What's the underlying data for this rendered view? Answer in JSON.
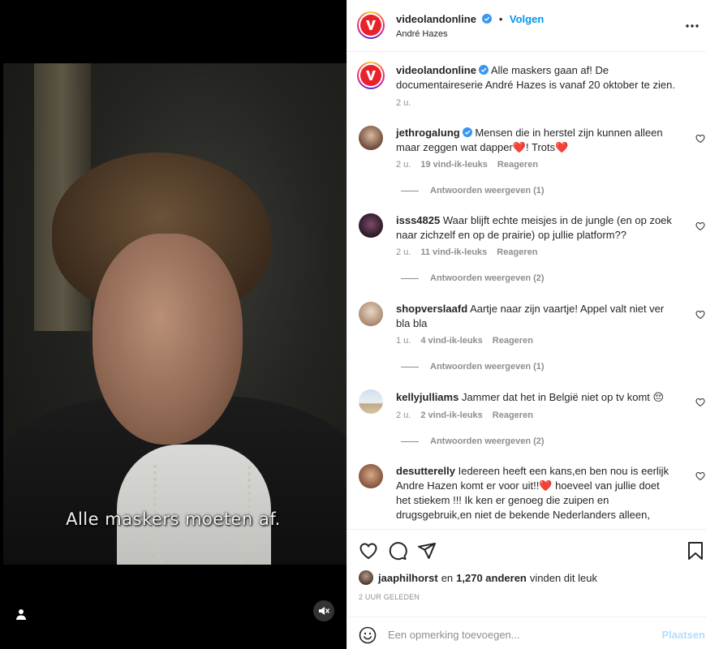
{
  "media": {
    "subtitle": "Alle maskers moeten af."
  },
  "header": {
    "username": "videolandonline",
    "follow_label": "Volgen",
    "separator": "•",
    "location": "André Hazes"
  },
  "caption": {
    "username": "videolandonline",
    "text": "Alle maskers gaan af! De documentaireserie André Hazes is vanaf 20 oktober te zien.",
    "time": "2 u."
  },
  "comments": [
    {
      "username": "jethrogalung",
      "verified": true,
      "text": "Mensen die in herstel zijn kunnen alleen maar zeggen wat dapper❤️! Trots❤️",
      "time": "2 u.",
      "likes": "19 vind-ik-leuks",
      "reply_label": "Reageren",
      "view_replies": "Antwoorden weergeven (1)"
    },
    {
      "username": "isss4825",
      "verified": false,
      "text": "Waar blijft echte meisjes in de jungle (en op zoek naar zichzelf en op de prairie) op jullie platform??",
      "time": "2 u.",
      "likes": "11 vind-ik-leuks",
      "reply_label": "Reageren",
      "view_replies": "Antwoorden weergeven (2)"
    },
    {
      "username": "shopverslaafd",
      "verified": false,
      "text": "Aartje naar zijn vaartje! Appel valt niet ver bla bla",
      "time": "1 u.",
      "likes": "4 vind-ik-leuks",
      "reply_label": "Reageren",
      "view_replies": "Antwoorden weergeven (1)"
    },
    {
      "username": "kellyjulliams",
      "verified": false,
      "text": "Jammer dat het in België niet op tv komt 😔",
      "time": "2 u.",
      "likes": "2 vind-ik-leuks",
      "reply_label": "Reageren",
      "view_replies": "Antwoorden weergeven (2)"
    },
    {
      "username": "desutterelly",
      "verified": false,
      "text": "Iedereen heeft een kans,en ben nou is eerlijk Andre Hazen komt er voor uit!!❤️ hoeveel van jullie doet het stiekem !!! Ik ken er genoeg die zuipen en drugsgebruik,en niet de bekende Nederlanders alleen,"
    }
  ],
  "likes_summary": {
    "user": "jaaphilhorst",
    "connector": "en",
    "others": "1,270 anderen",
    "suffix": "vinden dit leuk"
  },
  "time_ago": "2 UUR GELEDEN",
  "add_comment": {
    "placeholder": "Een opmerking toevoegen...",
    "post_label": "Plaatsen"
  },
  "colors": {
    "accent": "#0095f6",
    "brand": "#e8212a",
    "muted": "#8e8e8e"
  },
  "icons": [
    "user-tag-icon",
    "mute-icon",
    "more-icon",
    "verified-icon",
    "heart-icon",
    "comment-icon",
    "share-icon",
    "bookmark-icon",
    "emoji-icon"
  ]
}
